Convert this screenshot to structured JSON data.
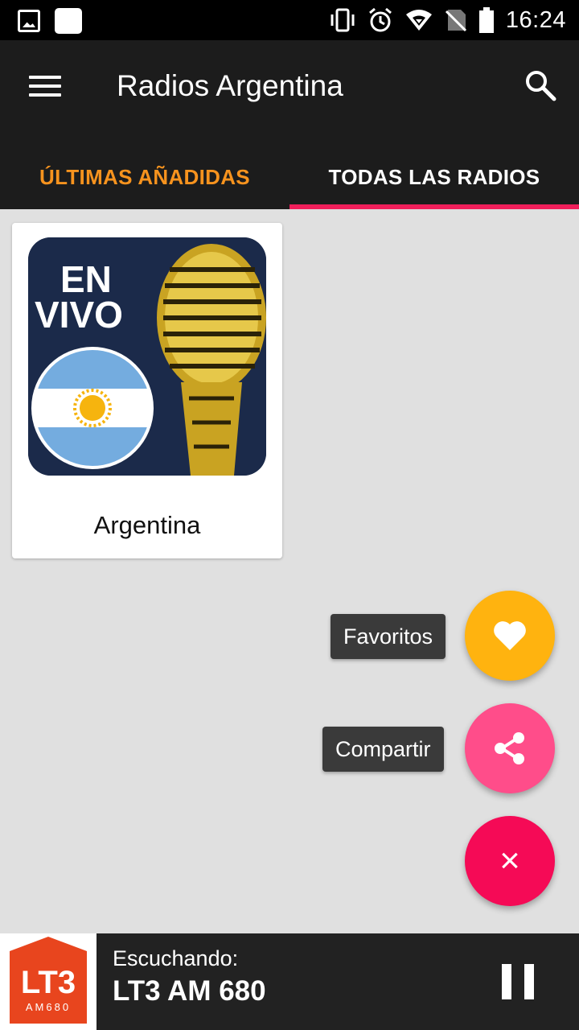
{
  "status_bar": {
    "time": "16:24",
    "icons": [
      "image-icon",
      "square-icon",
      "vibrate-icon",
      "alarm-icon",
      "wifi-icon",
      "no-signal-icon",
      "battery-icon"
    ]
  },
  "app_bar": {
    "title": "Radios Argentina",
    "menu_icon": "hamburger-icon",
    "search_icon": "search-icon"
  },
  "tabs": [
    {
      "label": "ÚLTIMAS AÑADIDAS",
      "color": "#f7931e"
    },
    {
      "label": "TODAS LAS RADIOS",
      "color": "#ffffff",
      "selected": true
    }
  ],
  "cards": [
    {
      "label": "Argentina",
      "art_text_1": "EN",
      "art_text_2": "VIVO"
    }
  ],
  "fab_menu": {
    "favorites_label": "Favoritos",
    "share_label": "Compartir",
    "close_symbol": "×",
    "colors": {
      "favorites": "#ffb30f",
      "share": "#ff4d8a",
      "close": "#f50a56"
    }
  },
  "player": {
    "listening_label": "Escuchando:",
    "station": "LT3 AM 680",
    "logo_main": "LT3",
    "logo_sub": "AM680"
  }
}
